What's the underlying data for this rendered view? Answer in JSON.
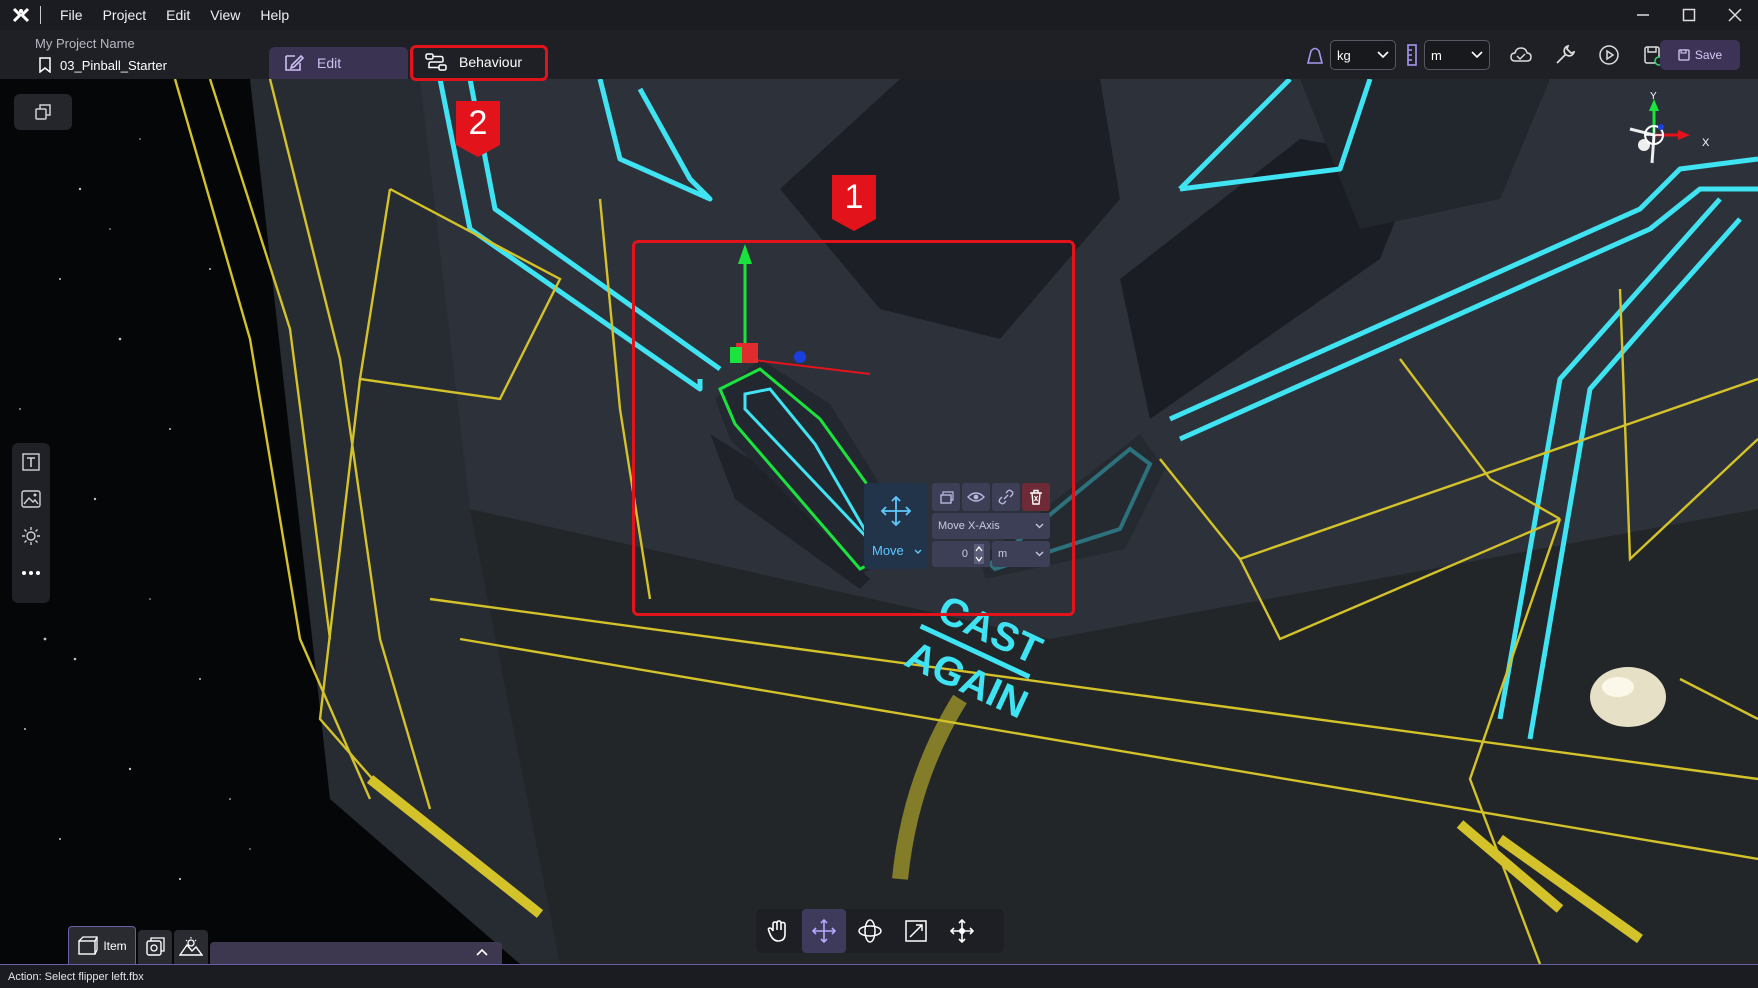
{
  "menu": [
    "File",
    "Project",
    "Edit",
    "View",
    "Help"
  ],
  "window_controls": [
    "minimize-icon",
    "maximize-icon",
    "close-icon"
  ],
  "header": {
    "project_name": "My Project Name",
    "scene_name": "03_Pinball_Starter",
    "tabs": {
      "edit": "Edit",
      "behaviour": "Behaviour"
    },
    "mass_unit": "kg",
    "length_unit": "m",
    "save_label": "Save"
  },
  "callouts": {
    "one": "1",
    "two": "2"
  },
  "gizmo_popup": {
    "mode_label": "Move",
    "axis_select": "Move X-Axis",
    "value": "0",
    "unit": "m"
  },
  "axes": {
    "y": "Y",
    "x": "X"
  },
  "scene_text": [
    "CAST",
    "AGAIN"
  ],
  "bottom_panel": {
    "item_tab": "Item"
  },
  "status": "Action: Select flipper left.fbx",
  "colors": {
    "accent": "#6a5fa7",
    "highlight": "#e3131b",
    "neon": "#3fe3f2",
    "wire": "#d4c22a"
  }
}
